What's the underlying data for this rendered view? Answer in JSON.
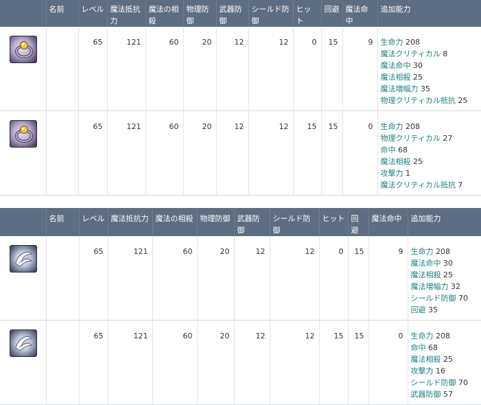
{
  "table1": {
    "headers": [
      "",
      "名前",
      "レベル",
      "魔法抵抗力",
      "魔法の相殺",
      "物理防御",
      "武器防御",
      "シールド防御",
      "ヒット",
      "回避",
      "魔法命中",
      "追加能力"
    ],
    "rows": [
      {
        "icon": "ring-icon",
        "name": "",
        "level": "65",
        "magic_resist": "121",
        "magic_offset": "60",
        "phys_def": "20",
        "weapon_def": "12",
        "shield_def": "12",
        "hit": "0",
        "evasion": "15",
        "magic_acc": "9",
        "extras": [
          {
            "label": "生命力",
            "value": "208"
          },
          {
            "label": "魔法クリティカル",
            "value": "8"
          },
          {
            "label": "魔法命中",
            "value": "30"
          },
          {
            "label": "魔法相殺",
            "value": "25"
          },
          {
            "label": "魔法増幅力",
            "value": "35"
          },
          {
            "label": "物理クリティカル抵抗",
            "value": "25"
          }
        ]
      },
      {
        "icon": "ring-icon",
        "name": "",
        "level": "65",
        "magic_resist": "121",
        "magic_offset": "60",
        "phys_def": "20",
        "weapon_def": "12",
        "shield_def": "12",
        "hit": "15",
        "evasion": "15",
        "magic_acc": "0",
        "extras": [
          {
            "label": "生命力",
            "value": "208"
          },
          {
            "label": "物理クリティカル",
            "value": "27"
          },
          {
            "label": "命中",
            "value": "68"
          },
          {
            "label": "魔法相殺",
            "value": "25"
          },
          {
            "label": "攻撃力",
            "value": "1"
          },
          {
            "label": "魔法クリティカル抵抗",
            "value": "7"
          }
        ]
      }
    ]
  },
  "table2": {
    "headers": [
      "",
      "名前",
      "レベル",
      "魔法抵抗力",
      "魔法の相殺",
      "物理防御",
      "武器防御",
      "シールド防御",
      "ヒット",
      "回避",
      "魔法命中",
      "追加能力"
    ],
    "rows": [
      {
        "icon": "wing-icon",
        "name": "",
        "level": "65",
        "magic_resist": "121",
        "magic_offset": "60",
        "phys_def": "20",
        "weapon_def": "12",
        "shield_def": "12",
        "hit": "0",
        "evasion": "15",
        "magic_acc": "9",
        "extras": [
          {
            "label": "生命力",
            "value": "208"
          },
          {
            "label": "魔法命中",
            "value": "30"
          },
          {
            "label": "魔法相殺",
            "value": "25"
          },
          {
            "label": "魔法増幅力",
            "value": "32"
          },
          {
            "label": "シールド防御",
            "value": "70"
          },
          {
            "label": "回避",
            "value": "35"
          }
        ]
      },
      {
        "icon": "wing-icon",
        "name": "",
        "level": "65",
        "magic_resist": "121",
        "magic_offset": "60",
        "phys_def": "20",
        "weapon_def": "12",
        "shield_def": "12",
        "hit": "15",
        "evasion": "15",
        "magic_acc": "0",
        "extras": [
          {
            "label": "生命力",
            "value": "208"
          },
          {
            "label": "命中",
            "value": "68"
          },
          {
            "label": "魔法相殺",
            "value": "25"
          },
          {
            "label": "攻撃力",
            "value": "16"
          },
          {
            "label": "シールド防御",
            "value": "70"
          },
          {
            "label": "武器防御",
            "value": "57"
          }
        ]
      }
    ]
  }
}
